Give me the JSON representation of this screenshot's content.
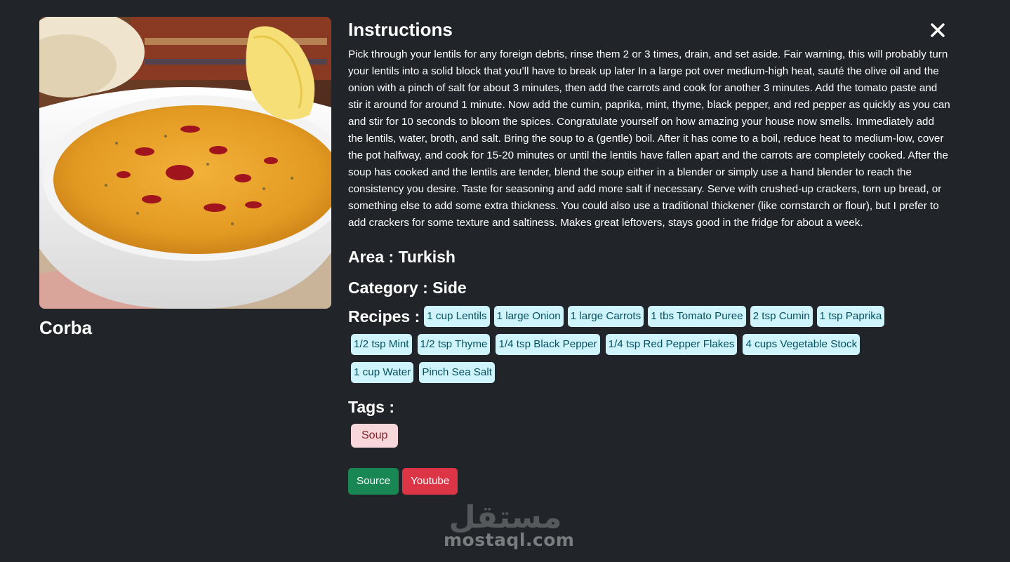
{
  "meal": {
    "name": "Corba",
    "instructions_heading": "Instructions",
    "instructions": "Pick through your lentils for any foreign debris, rinse them 2 or 3 times, drain, and set aside. Fair warning, this will probably turn your lentils into a solid block that you’ll have to break up later In a large pot over medium-high heat, sauté the olive oil and the onion with a pinch of salt for about 3 minutes, then add the carrots and cook for another 3 minutes. Add the tomato paste and stir it around for around 1 minute. Now add the cumin, paprika, mint, thyme, black pepper, and red pepper as quickly as you can and stir for 10 seconds to bloom the spices. Congratulate yourself on how amazing your house now smells. Immediately add the lentils, water, broth, and salt. Bring the soup to a (gentle) boil. After it has come to a boil, reduce heat to medium-low, cover the pot halfway, and cook for 15-20 minutes or until the lentils have fallen apart and the carrots are completely cooked. After the soup has cooked and the lentils are tender, blend the soup either in a blender or simply use a hand blender to reach the consistency you desire. Taste for seasoning and add more salt if necessary. Serve with crushed-up crackers, torn up bread, or something else to add some extra thickness. You could also use a traditional thickener (like cornstarch or flour), but I prefer to add crackers for some texture and saltiness. Makes great leftovers, stays good in the fridge for about a week.",
    "area_line": "Area : Turkish",
    "category_line": "Category : Side",
    "recipes_label": "Recipes :",
    "ingredients_row1": [
      "1 cup Lentils",
      "1 large Onion",
      "1 large Carrots",
      "1 tbs Tomato Puree",
      "2 tsp Cumin",
      "1 tsp Paprika"
    ],
    "ingredients_rest": [
      "1/2 tsp Mint",
      "1/2 tsp Thyme",
      "1/4 tsp Black Pepper",
      "1/4 tsp Red Pepper Flakes",
      "4 cups Vegetable Stock",
      "1 cup Water",
      "Pinch Sea Salt"
    ],
    "tags_label": "Tags :",
    "tags": [
      "Soup"
    ],
    "source_label": "Source",
    "youtube_label": "Youtube"
  },
  "watermark": {
    "text": "mostaql.com",
    "arabic": "مستقل"
  },
  "icons": {
    "close": "close-icon",
    "image": "soup-bowl-image"
  },
  "colors": {
    "background": "#212529",
    "chip_bg": "#cff4fc",
    "chip_text": "#055160",
    "tag_bg": "#f8d7da",
    "tag_text": "#842029",
    "source_btn": "#198754",
    "youtube_btn": "#dc3545"
  }
}
